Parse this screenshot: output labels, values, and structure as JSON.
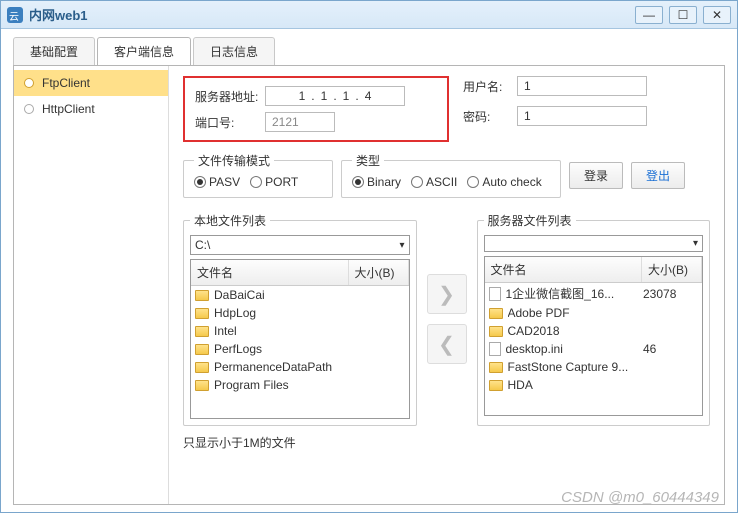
{
  "window": {
    "title": "内网web1"
  },
  "winbtns": {
    "min": "—",
    "max": "☐",
    "close": "✕"
  },
  "tabs": [
    {
      "label": "基础配置"
    },
    {
      "label": "客户端信息"
    },
    {
      "label": "日志信息"
    }
  ],
  "sidebar": [
    {
      "label": "FtpClient"
    },
    {
      "label": "HttpClient"
    }
  ],
  "server": {
    "addr_label": "服务器地址:",
    "ip": [
      "1",
      "1",
      "1",
      "4"
    ],
    "port_label": "端口号:",
    "port": "2121"
  },
  "creds": {
    "user_label": "用户名:",
    "user": "1",
    "pass_label": "密码:",
    "pass": "1"
  },
  "mode": {
    "legend": "文件传输模式",
    "pasv": "PASV",
    "port": "PORT"
  },
  "type": {
    "legend": "类型",
    "binary": "Binary",
    "ascii": "ASCII",
    "auto": "Auto check"
  },
  "buttons": {
    "login": "登录",
    "logout": "登出"
  },
  "local": {
    "legend": "本地文件列表",
    "path": "C:\\",
    "cols": {
      "name": "文件名",
      "size": "大小(B)"
    },
    "rows": [
      {
        "name": "DaBaiCai",
        "size": "",
        "icon": "folder"
      },
      {
        "name": "HdpLog",
        "size": "",
        "icon": "folder"
      },
      {
        "name": "Intel",
        "size": "",
        "icon": "folder"
      },
      {
        "name": "PerfLogs",
        "size": "",
        "icon": "folder"
      },
      {
        "name": "PermanenceDataPath",
        "size": "",
        "icon": "folder"
      },
      {
        "name": "Program Files",
        "size": "",
        "icon": "folder"
      }
    ]
  },
  "remote": {
    "legend": "服务器文件列表",
    "path": "",
    "cols": {
      "name": "文件名",
      "size": "大小(B)"
    },
    "rows": [
      {
        "name": "1企业微信截图_16...",
        "size": "23078",
        "icon": "file"
      },
      {
        "name": "Adobe PDF",
        "size": "",
        "icon": "folder"
      },
      {
        "name": "CAD2018",
        "size": "",
        "icon": "folder"
      },
      {
        "name": "desktop.ini",
        "size": "46",
        "icon": "file"
      },
      {
        "name": "FastStone Capture 9...",
        "size": "",
        "icon": "folder"
      },
      {
        "name": "HDA",
        "size": "",
        "icon": "folder"
      }
    ]
  },
  "footer": "只显示小于1M的文件",
  "watermark": "CSDN @m0_60444349"
}
